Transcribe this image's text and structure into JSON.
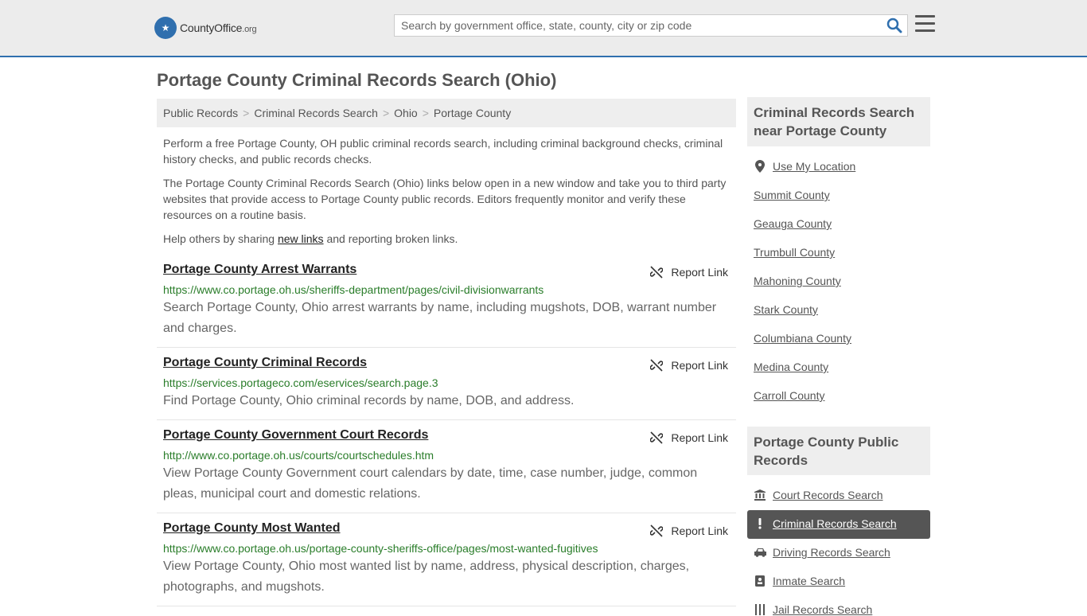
{
  "header": {
    "logo_main": "CountyOffice",
    "logo_suffix": ".org",
    "search_placeholder": "Search by government office, state, county, city or zip code"
  },
  "page": {
    "title": "Portage County Criminal Records Search (Ohio)"
  },
  "breadcrumb": [
    "Public Records",
    "Criminal Records Search",
    "Ohio",
    "Portage County"
  ],
  "intro": {
    "p1": "Perform a free Portage County, OH public criminal records search, including criminal background checks, criminal history checks, and public records checks.",
    "p2": "The Portage County Criminal Records Search (Ohio) links below open in a new window and take you to third party websites that provide access to Portage County public records. Editors frequently monitor and verify these resources on a routine basis.",
    "p3_before": "Help others by sharing ",
    "p3_link": "new links",
    "p3_after": " and reporting broken links."
  },
  "results": [
    {
      "title": "Portage County Arrest Warrants",
      "url": "https://www.co.portage.oh.us/sheriffs-department/pages/civil-divisionwarrants",
      "desc": "Search Portage County, Ohio arrest warrants by name, including mugshots, DOB, warrant number and charges.",
      "report": "Report Link"
    },
    {
      "title": "Portage County Criminal Records",
      "url": "https://services.portageco.com/eservices/search.page.3",
      "desc": "Find Portage County, Ohio criminal records by name, DOB, and address.",
      "report": "Report Link"
    },
    {
      "title": "Portage County Government Court Records",
      "url": "http://www.co.portage.oh.us/courts/courtschedules.htm",
      "desc": "View Portage County Government court calendars by date, time, case number, judge, common pleas, municipal court and domestic relations.",
      "report": "Report Link"
    },
    {
      "title": "Portage County Most Wanted",
      "url": "https://www.co.portage.oh.us/portage-county-sheriffs-office/pages/most-wanted-fugitives",
      "desc": "View Portage County, Ohio most wanted list by name, address, physical description, charges, photographs, and mugshots.",
      "report": "Report Link"
    }
  ],
  "sidebar": {
    "nearby_title": "Criminal Records Search near Portage County",
    "use_location": "Use My Location",
    "nearby": [
      "Summit County",
      "Geauga County",
      "Trumbull County",
      "Mahoning County",
      "Stark County",
      "Columbiana County",
      "Medina County",
      "Carroll County"
    ],
    "public_title": "Portage County Public Records",
    "public_links": [
      {
        "label": "Court Records Search",
        "icon": "courthouse-icon"
      },
      {
        "label": "Criminal Records Search",
        "icon": "exclamation-icon"
      },
      {
        "label": "Driving Records Search",
        "icon": "car-icon"
      },
      {
        "label": "Inmate Search",
        "icon": "id-badge-icon"
      },
      {
        "label": "Jail Records Search",
        "icon": "jail-icon"
      }
    ]
  },
  "colors": {
    "accent": "#2f6fae",
    "url_green": "#2a7d2a",
    "active_bg": "#555555"
  }
}
